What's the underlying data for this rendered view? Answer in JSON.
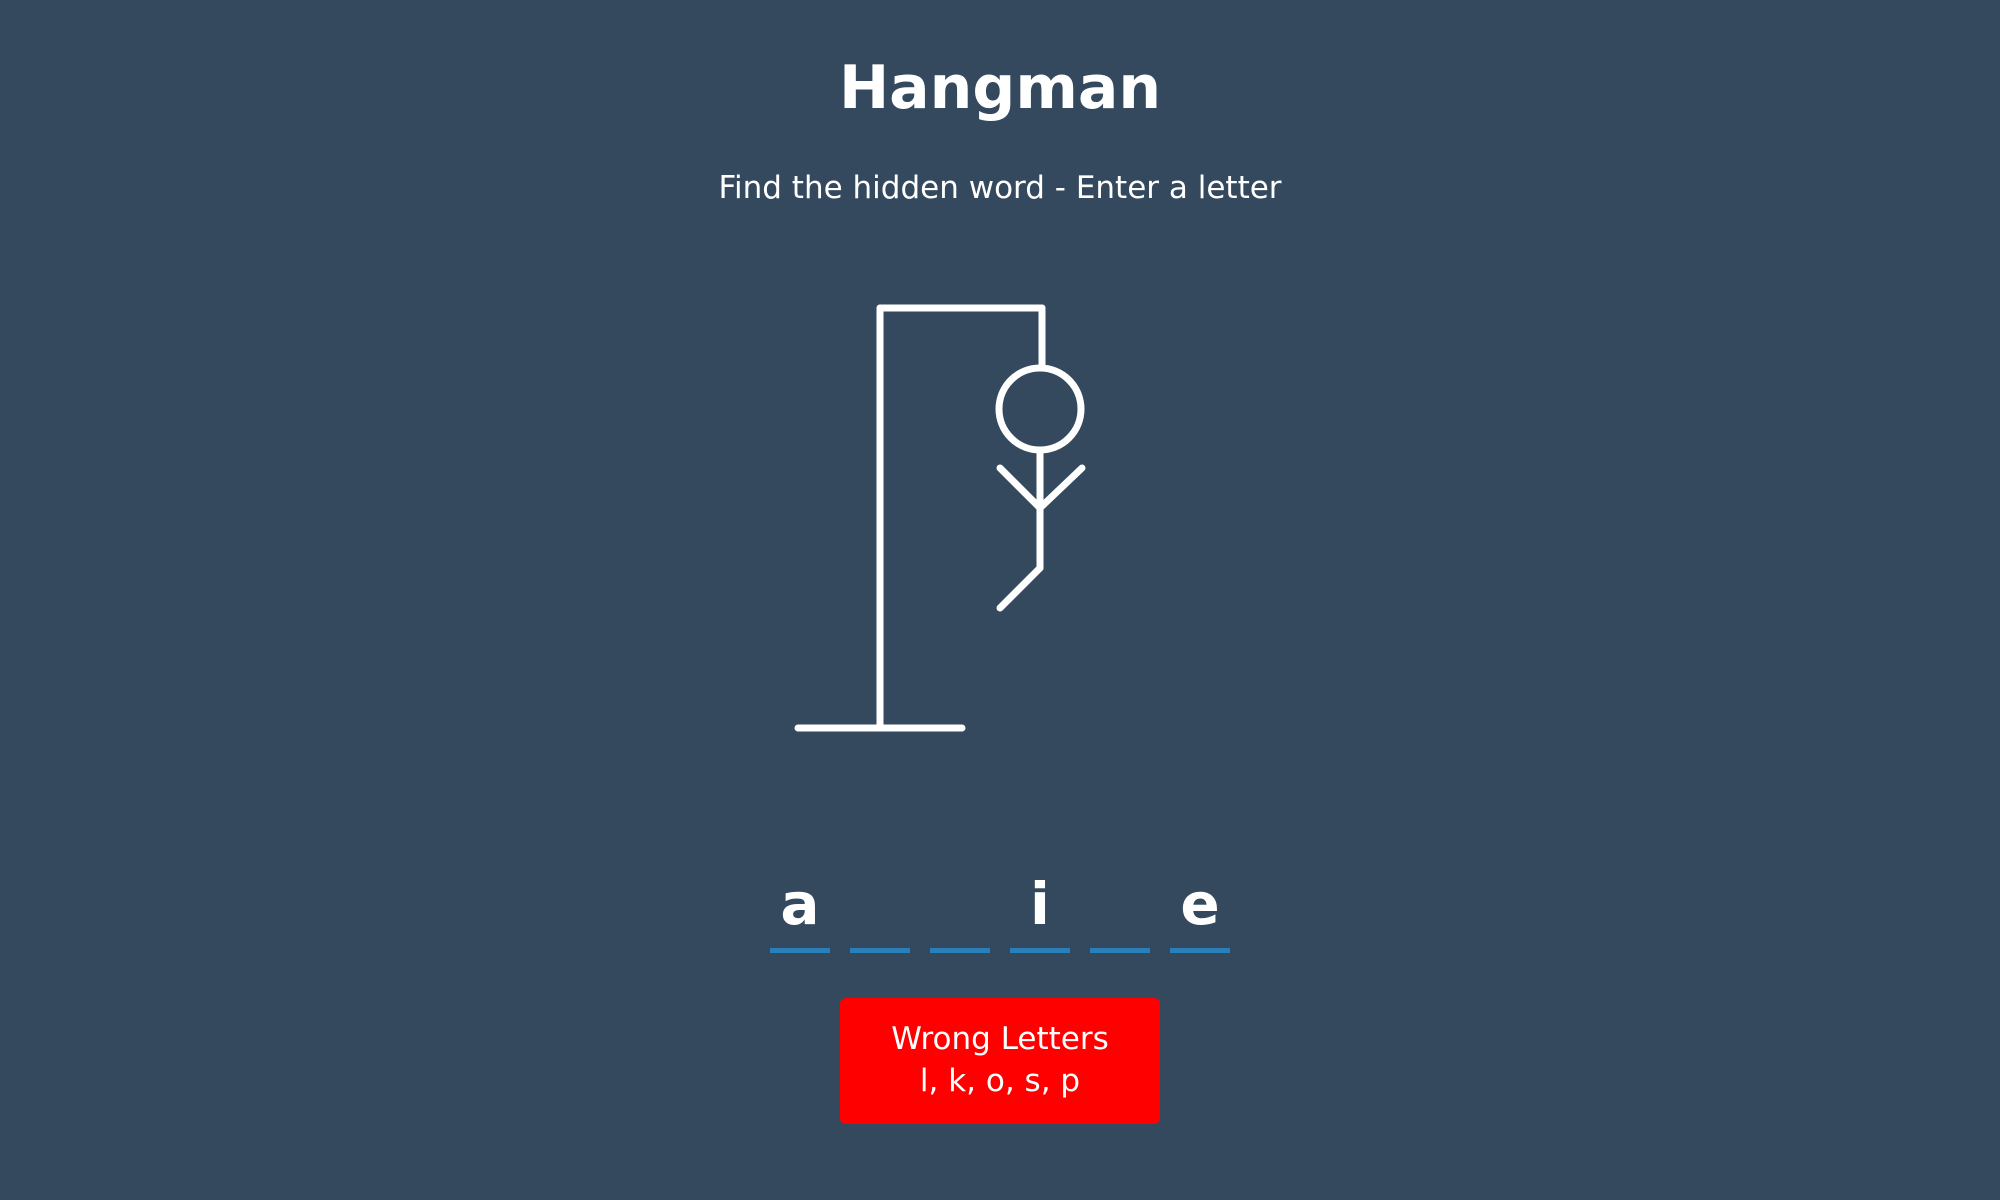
{
  "header": {
    "title": "Hangman",
    "subtitle": "Find the hidden word - Enter a letter"
  },
  "game": {
    "word_slots": [
      "a",
      "",
      "",
      "i",
      "",
      "e"
    ],
    "wrong_letters_title": "Wrong Letters",
    "wrong_letters": "l, k, o, s, p",
    "wrong_letter_count": 5
  },
  "colors": {
    "background": "#34495e",
    "slot_underline": "#2980b9",
    "wrong_box": "#ff0000",
    "drawing": "#ffffff"
  }
}
